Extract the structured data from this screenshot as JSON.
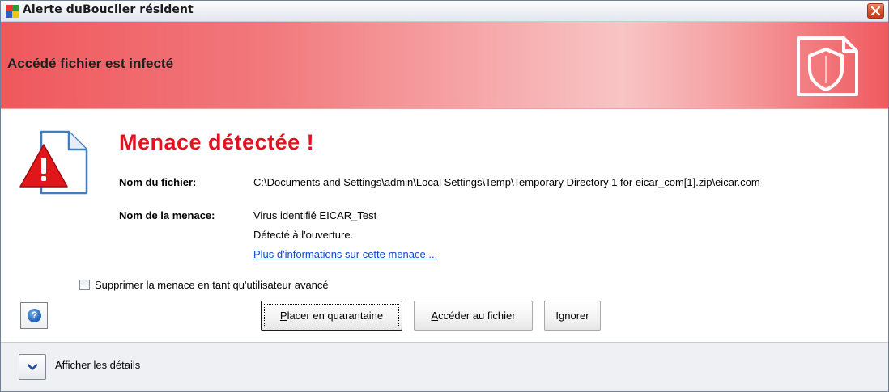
{
  "window": {
    "title": "Alerte duBouclier résident"
  },
  "banner": {
    "heading": "Accédé fichier est infecté"
  },
  "threat": {
    "title": "Menace détectée !",
    "file_name_label": "Nom du fichier:",
    "file_name_value": "C:\\Documents and Settings\\admin\\Local Settings\\Temp\\Temporary Directory 1 for eicar_com[1].zip\\eicar.com",
    "threat_name_label": "Nom de la menace:",
    "threat_name_value": "Virus identifié EICAR_Test",
    "detected_text": "Détecté à l'ouverture.",
    "more_info_link": "Plus d'informations sur cette menace ..."
  },
  "options": {
    "delete_checkbox_label": "Supprimer la menace en tant qu'utilisateur avancé",
    "delete_checkbox_checked": false
  },
  "buttons": {
    "help_symbol": "?",
    "quarantine_access_key": "P",
    "quarantine_rest": "lacer en quarantaine",
    "open_file_access_key": "A",
    "open_file_rest": "ccéder au fichier",
    "ignore_pre": "I",
    "ignore_access_key": "g",
    "ignore_rest": "norer"
  },
  "footer": {
    "show_details_label": "Afficher les détails"
  },
  "icons": {
    "app": "avg-app-icon",
    "close": "close-icon",
    "banner": "shield-document-icon",
    "warning": "warning-document-icon",
    "help": "help-icon",
    "expand": "chevron-down-icon"
  },
  "colors": {
    "banner_red": "#ef585d",
    "threat_title": "#e2121e",
    "link": "#1248c8"
  }
}
